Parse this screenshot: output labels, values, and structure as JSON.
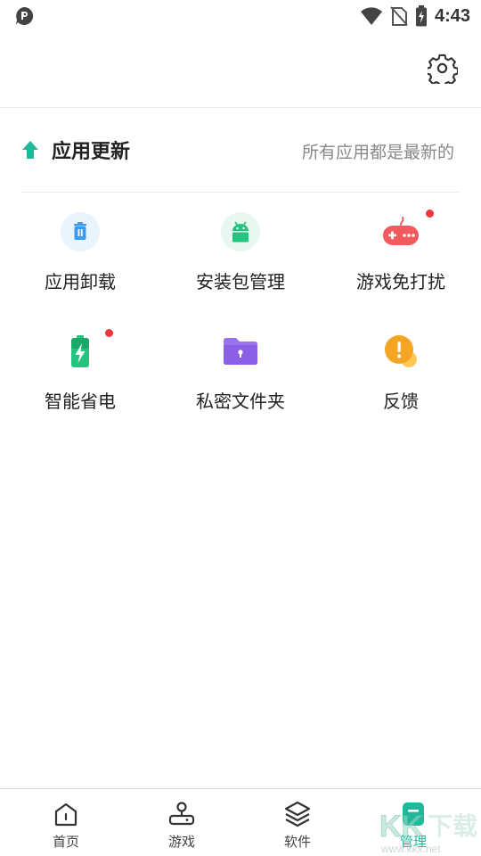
{
  "status_bar": {
    "time": "4:43"
  },
  "update": {
    "title": "应用更新",
    "status": "所有应用都是最新的"
  },
  "tools": [
    {
      "label": "应用卸载",
      "icon": "trash-icon",
      "badge": false
    },
    {
      "label": "安装包管理",
      "icon": "android-package-icon",
      "badge": false
    },
    {
      "label": "游戏免打扰",
      "icon": "gamepad-icon",
      "badge": true
    },
    {
      "label": "智能省电",
      "icon": "battery-icon",
      "badge": true
    },
    {
      "label": "私密文件夹",
      "icon": "locked-folder-icon",
      "badge": false
    },
    {
      "label": "反馈",
      "icon": "feedback-icon",
      "badge": false
    }
  ],
  "nav": [
    {
      "label": "首页",
      "icon": "home-icon"
    },
    {
      "label": "游戏",
      "icon": "joystick-icon"
    },
    {
      "label": "软件",
      "icon": "layers-icon"
    },
    {
      "label": "管理",
      "icon": "manage-icon",
      "active": true
    }
  ],
  "colors": {
    "accent": "#1fb89a",
    "badge": "#f0353b"
  }
}
